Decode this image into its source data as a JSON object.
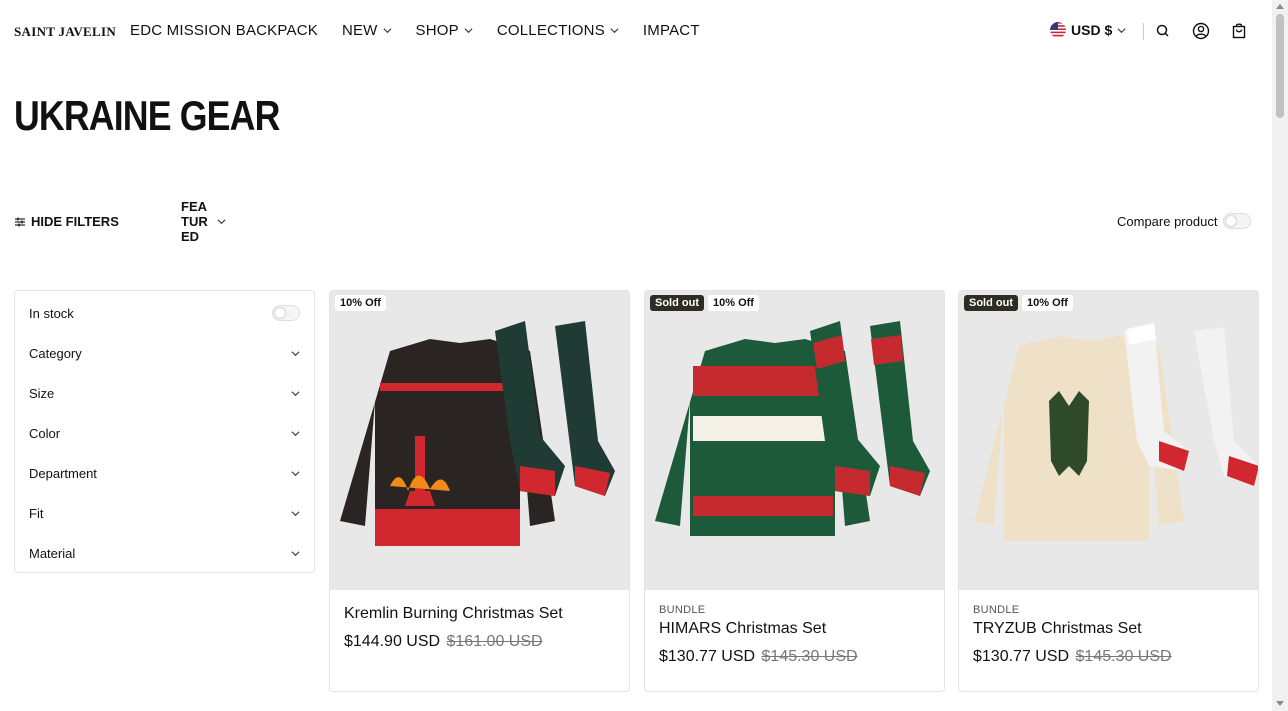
{
  "header": {
    "logo": "SAINT JAVELIN",
    "nav": [
      {
        "label": "EDC MISSION BACKPACK",
        "has_dropdown": false
      },
      {
        "label": "NEW",
        "has_dropdown": true
      },
      {
        "label": "SHOP",
        "has_dropdown": true
      },
      {
        "label": "COLLECTIONS",
        "has_dropdown": true
      },
      {
        "label": "IMPACT",
        "has_dropdown": false
      }
    ],
    "currency": "USD $",
    "icons": [
      "flag-us-icon",
      "search-icon",
      "account-icon",
      "cart-icon"
    ]
  },
  "page": {
    "title": "UKRAINE GEAR"
  },
  "toolbar": {
    "hide_filters": "HIDE FILTERS",
    "sort_label": "FEATURED",
    "compare_label": "Compare product"
  },
  "filters": [
    {
      "label": "In stock",
      "type": "toggle"
    },
    {
      "label": "Category",
      "type": "dropdown"
    },
    {
      "label": "Size",
      "type": "dropdown"
    },
    {
      "label": "Color",
      "type": "dropdown"
    },
    {
      "label": "Department",
      "type": "dropdown"
    },
    {
      "label": "Fit",
      "type": "dropdown"
    },
    {
      "label": "Material",
      "type": "dropdown"
    }
  ],
  "products": [
    {
      "badges": [
        "10% Off"
      ],
      "vendor": "",
      "title": "Kremlin Burning Christmas Set",
      "price": "$144.90 USD",
      "compare_at": "$161.00 USD",
      "sweater_color": "#2a2523",
      "sock_color": "#1f3b34"
    },
    {
      "badges": [
        "Sold out",
        "10% Off"
      ],
      "vendor": "BUNDLE",
      "title": "HIMARS Christmas Set",
      "price": "$130.77 USD",
      "compare_at": "$145.30 USD",
      "sweater_color": "#1c5a3a",
      "sock_color": "#1c5a3a"
    },
    {
      "badges": [
        "Sold out",
        "10% Off"
      ],
      "vendor": "BUNDLE",
      "title": "TRYZUB Christmas Set",
      "price": "$130.77 USD",
      "compare_at": "$145.30 USD",
      "sweater_color": "#efe1c7",
      "sock_color": "#f2f2f2"
    }
  ],
  "colors": {
    "accent_red": "#d0282e",
    "sold_badge": "#2f2c26"
  }
}
